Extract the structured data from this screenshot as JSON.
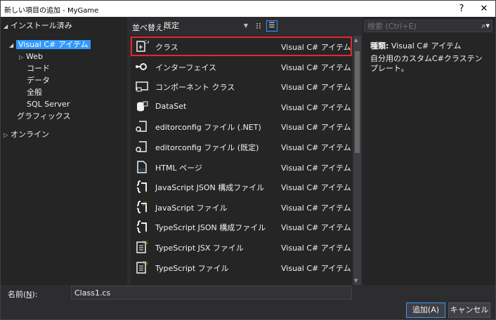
{
  "window": {
    "title": "新しい項目の追加 - MyGame",
    "help": "?",
    "close": "✕"
  },
  "tree": {
    "installed": "インストール済み",
    "visual_cs": "Visual C# アイテム",
    "web": "Web",
    "code": "コード",
    "data": "データ",
    "general": "全般",
    "sql_server": "SQL Server",
    "graphics": "グラフィックス",
    "online": "オンライン"
  },
  "sort": {
    "label": "並べ替え:",
    "value": "既定"
  },
  "items": [
    {
      "name": "クラス",
      "type": "Visual C# アイテム",
      "icon": "class-icon"
    },
    {
      "name": "インターフェイス",
      "type": "Visual C# アイテム",
      "icon": "interface-icon"
    },
    {
      "name": "コンポーネント クラス",
      "type": "Visual C# アイテム",
      "icon": "component-icon"
    },
    {
      "name": "DataSet",
      "type": "Visual C# アイテム",
      "icon": "dataset-icon"
    },
    {
      "name": "editorconfig ファイル (.NET)",
      "type": "Visual C# アイテム",
      "icon": "editorconfig-icon"
    },
    {
      "name": "editorconfig ファイル (既定)",
      "type": "Visual C# アイテム",
      "icon": "editorconfig-icon"
    },
    {
      "name": "HTML ページ",
      "type": "Visual C# アイテム",
      "icon": "html-icon"
    },
    {
      "name": "JavaScript JSON 構成ファイル",
      "type": "Visual C# アイテム",
      "icon": "json-config-icon"
    },
    {
      "name": "JavaScript ファイル",
      "type": "Visual C# アイテム",
      "icon": "js-file-icon"
    },
    {
      "name": "TypeScript JSON 構成ファイル",
      "type": "Visual C# アイテム",
      "icon": "json-config-icon"
    },
    {
      "name": "TypeScript JSX ファイル",
      "type": "Visual C# アイテム",
      "icon": "ts-file-icon"
    },
    {
      "name": "TypeScript ファイル",
      "type": "Visual C# アイテム",
      "icon": "ts-file-icon"
    }
  ],
  "search": {
    "placeholder": "検索 (Ctrl+E)"
  },
  "details": {
    "type_label": "種類:",
    "type_value": "Visual C# アイテム",
    "description": "自分用のカスタムC#クラステンプレート。"
  },
  "name_field": {
    "label_pre": "名前(",
    "label_key": "N",
    "label_post": "):",
    "value": "Class1.cs"
  },
  "buttons": {
    "add": "追加(A)",
    "cancel": "キャンセル"
  },
  "colors": {
    "accent": "#3399ff",
    "highlight": "#e8262d"
  }
}
